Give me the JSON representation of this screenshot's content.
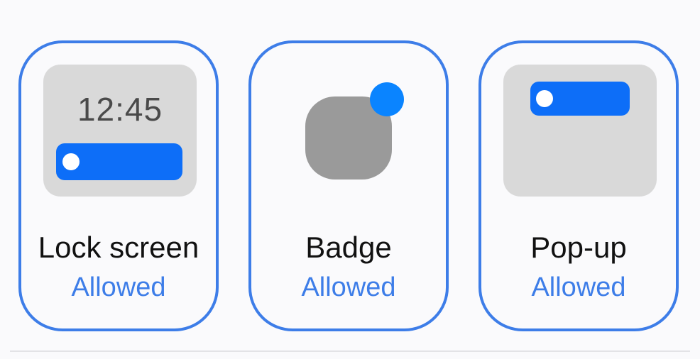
{
  "cards": [
    {
      "id": "lock-screen",
      "title": "Lock screen",
      "status": "Allowed",
      "preview_time": "12:45",
      "selected": true
    },
    {
      "id": "badge",
      "title": "Badge",
      "status": "Allowed",
      "selected": true
    },
    {
      "id": "pop-up",
      "title": "Pop-up",
      "status": "Allowed",
      "selected": true
    }
  ],
  "colors": {
    "accent": "#3d7de8",
    "notification_bar": "#0d6ef8",
    "badge_dot": "#0a84ff",
    "preview_background": "#d9d9d9",
    "app_icon": "#9a9a9a"
  }
}
